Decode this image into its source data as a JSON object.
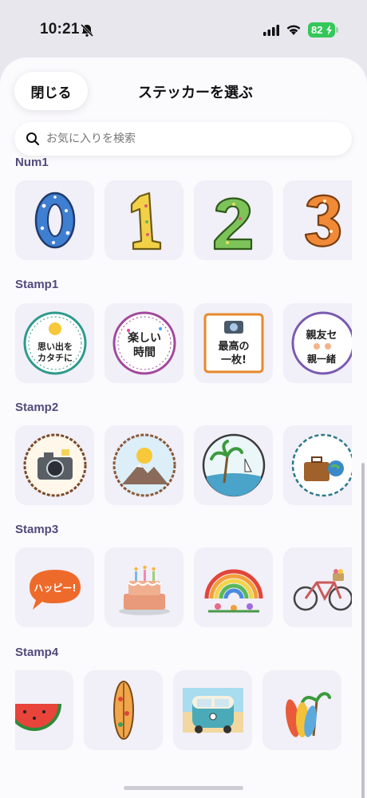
{
  "status": {
    "time": "10:21",
    "battery": "82"
  },
  "header": {
    "close_label": "閉じる",
    "title": "ステッカーを選ぶ"
  },
  "search": {
    "placeholder": "お気に入りを検索"
  },
  "sections": [
    {
      "title": "Num1",
      "items": [
        "0",
        "1",
        "2",
        "3"
      ]
    },
    {
      "title": "Stamp1",
      "items": [
        "思い出を\nカタチに",
        "楽しい\n時間",
        "最高の\n一枚!",
        "親友セ\n親一緒"
      ]
    },
    {
      "title": "Stamp2",
      "items": [
        "camera-badge",
        "mountain-sun-badge",
        "palm-beach-badge",
        "travel-suitcase-badge"
      ]
    },
    {
      "title": "Stamp3",
      "items": [
        "ハッピー!",
        "birthday-cake",
        "rainbow-flowers",
        "bicycle"
      ]
    },
    {
      "title": "Stamp4",
      "items": [
        "watermelon",
        "surfboard",
        "camper-van",
        "surfboards-palms"
      ]
    }
  ],
  "colors": {
    "section_title": "#514a7c",
    "battery": "#34c759",
    "tile_bg": "#f1eff7"
  }
}
